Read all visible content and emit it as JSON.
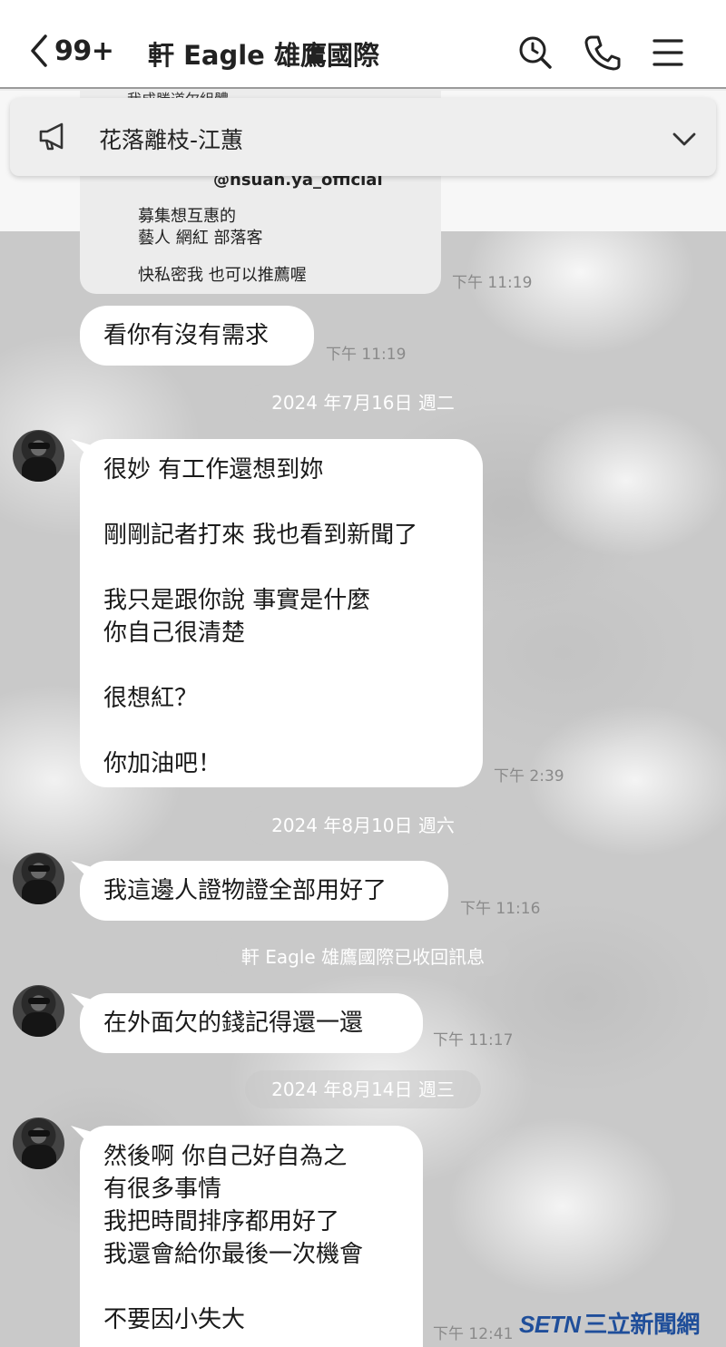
{
  "header": {
    "unread_count": "99+",
    "title": "軒 Eagle 雄鷹國際"
  },
  "announcement": {
    "text": "花落離枝-江蕙"
  },
  "image_card": {
    "cut_text": "我成勝道尔組體",
    "handle": "@hsuan.ya_official",
    "line1": "募集想互惠的",
    "line2": "藝人 網紅 部落客",
    "line3": "快私密我 也可以推薦喔",
    "time": "下午 11:19"
  },
  "messages": [
    {
      "lines": [
        "看你有沒有需求"
      ],
      "time": "下午 11:19"
    },
    {
      "lines": [
        "很妙 有工作還想到妳",
        "",
        "剛剛記者打來 我也看到新聞了",
        "",
        "我只是跟你說 事實是什麼",
        "你自己很清楚",
        "",
        "很想紅？",
        "",
        "你加油吧！"
      ],
      "time": "下午 2:39"
    },
    {
      "lines": [
        "我這邊人證物證全部用好了"
      ],
      "time": "下午 11:16"
    },
    {
      "lines": [
        "在外面欠的錢記得還一還"
      ],
      "time": "下午 11:17"
    },
    {
      "lines": [
        "然後啊 你自己好自為之",
        "有很多事情",
        "我把時間排序都用好了",
        "我還會給你最後一次機會",
        "",
        "不要因小失大"
      ],
      "time": "下午 12:41"
    }
  ],
  "date_separators": [
    "2024 年7月16日 週二",
    "2024 年8月10日 週六",
    "2024 年8月14日 週三"
  ],
  "system_notice": "軒 Eagle 雄鷹國際已收回訊息",
  "watermark": {
    "latin": "SETN",
    "cn": "三立新聞網"
  },
  "colors": {
    "bubble": "#ffffff",
    "time": "#8a8a8a",
    "watermark": "#1f4e9a"
  },
  "icons": [
    "back-chevron-icon",
    "search-icon",
    "phone-icon",
    "menu-icon",
    "megaphone-icon",
    "chevron-down-icon"
  ]
}
